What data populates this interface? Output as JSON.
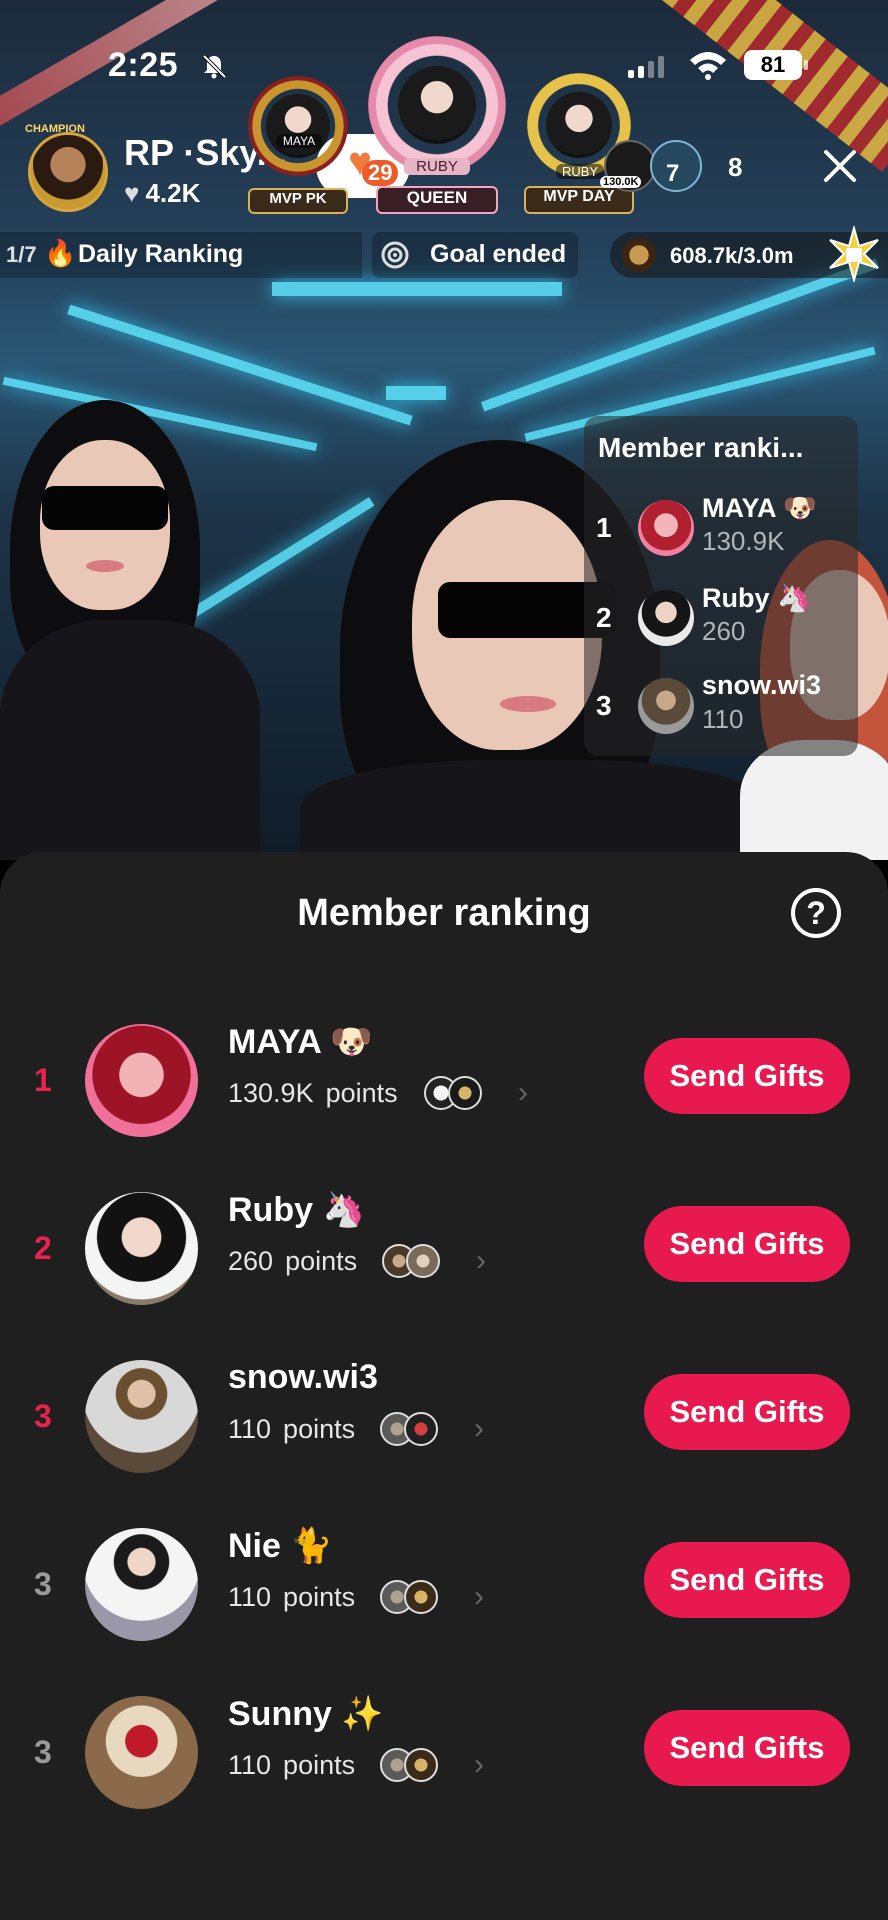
{
  "status_bar": {
    "time": "2:25",
    "battery": "81"
  },
  "host": {
    "name": "RP ·Sky...",
    "likes": "4.2K",
    "follow_count": "29",
    "avatar_ring_text": "CHAMPION"
  },
  "badges": [
    {
      "tag": "MVP PK",
      "sub": "MAYA",
      "icon": "gold-crown-frame-icon"
    },
    {
      "tag": "QUEEN",
      "sub": "RUBY",
      "icon": "pink-wing-frame-icon"
    },
    {
      "tag": "MVP DAY",
      "sub": "RUBY",
      "icon": "gold-laurel-frame-icon"
    }
  ],
  "viewers": {
    "top_viewer_points": "130.0K",
    "second_viewer_count": "7",
    "count": "8"
  },
  "top_strip": {
    "ranking_prefix": "1/7",
    "ranking_label": "Daily Ranking",
    "goal_label": "Goal ended",
    "coin_label": "608.7k/3.0m"
  },
  "overlay_ranking": {
    "title": "Member ranki...",
    "rows": [
      {
        "rank": "1",
        "name": "MAYA 🐶",
        "points": "130.9K"
      },
      {
        "rank": "2",
        "name": "Ruby 🦄",
        "points": "260"
      },
      {
        "rank": "3",
        "name": "snow.wi3",
        "points": "110"
      }
    ]
  },
  "sheet": {
    "title": "Member ranking",
    "help_label": "?",
    "points_word": "points",
    "send_label": "Send Gifts",
    "members": [
      {
        "rank": "1",
        "name": "MAYA 🐶",
        "points": "130.9K"
      },
      {
        "rank": "2",
        "name": "Ruby 🦄",
        "points": "260"
      },
      {
        "rank": "3",
        "name": "snow.wi3",
        "points": "110"
      },
      {
        "rank": "3",
        "name": "Nie 🐈",
        "points": "110"
      },
      {
        "rank": "3",
        "name": "Sunny ✨",
        "points": "110"
      }
    ]
  },
  "colors": {
    "accent": "#e8194f",
    "sheet_bg": "#1f1f1f",
    "rank_top": "#e8224f",
    "rank_other": "#9a9a9a"
  }
}
